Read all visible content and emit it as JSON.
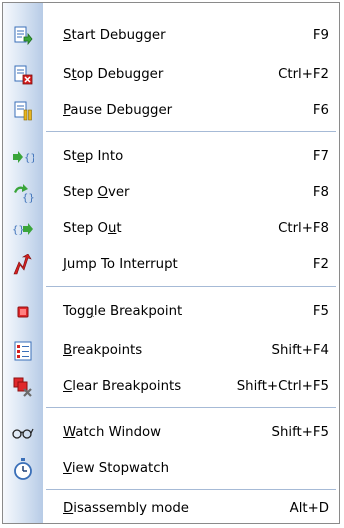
{
  "menu": {
    "items": [
      {
        "label": "Start Debugger",
        "mnemonic": 0,
        "shortcut": "F9",
        "icon": "start-debugger-icon"
      },
      {
        "label": "Stop Debugger",
        "mnemonic": 1,
        "shortcut": "Ctrl+F2",
        "icon": "stop-debugger-icon"
      },
      {
        "label": "Pause Debugger",
        "mnemonic": 0,
        "shortcut": "F6",
        "icon": "pause-debugger-icon"
      },
      {
        "label": "Step Into",
        "mnemonic": 2,
        "shortcut": "F7",
        "icon": "step-into-icon"
      },
      {
        "label": "Step Over",
        "mnemonic": 5,
        "shortcut": "F8",
        "icon": "step-over-icon"
      },
      {
        "label": "Step Out",
        "mnemonic": 6,
        "shortcut": "Ctrl+F8",
        "icon": "step-out-icon"
      },
      {
        "label": "Jump To Interrupt",
        "mnemonic": 0,
        "shortcut": "F2",
        "icon": "jump-to-interrupt-icon"
      },
      {
        "label": "Toggle Breakpoint",
        "mnemonic": 3,
        "shortcut": "F5",
        "icon": "toggle-breakpoint-icon"
      },
      {
        "label": "Breakpoints",
        "mnemonic": 0,
        "shortcut": "Shift+F4",
        "icon": "breakpoints-list-icon"
      },
      {
        "label": "Clear Breakpoints",
        "mnemonic": 0,
        "shortcut": "Shift+Ctrl+F5",
        "icon": "clear-breakpoints-icon"
      },
      {
        "label": "Watch Window",
        "mnemonic": 0,
        "shortcut": "Shift+F5",
        "icon": "watch-glasses-icon"
      },
      {
        "label": "View Stopwatch",
        "mnemonic": 0,
        "shortcut": "",
        "icon": "stopwatch-icon"
      },
      {
        "label": "Disassembly mode",
        "mnemonic": 0,
        "shortcut": "Alt+D",
        "icon": ""
      }
    ],
    "separators_after": [
      2,
      6,
      9,
      11
    ]
  },
  "colors": {
    "gutter_light": "#f6f9fd",
    "gutter_dark": "#b7cbe6",
    "separator": "#a6bad6",
    "border": "#8a8a8a",
    "icon_green": "#3aa53a",
    "icon_red": "#d42020",
    "icon_blue": "#3a6fb8"
  }
}
